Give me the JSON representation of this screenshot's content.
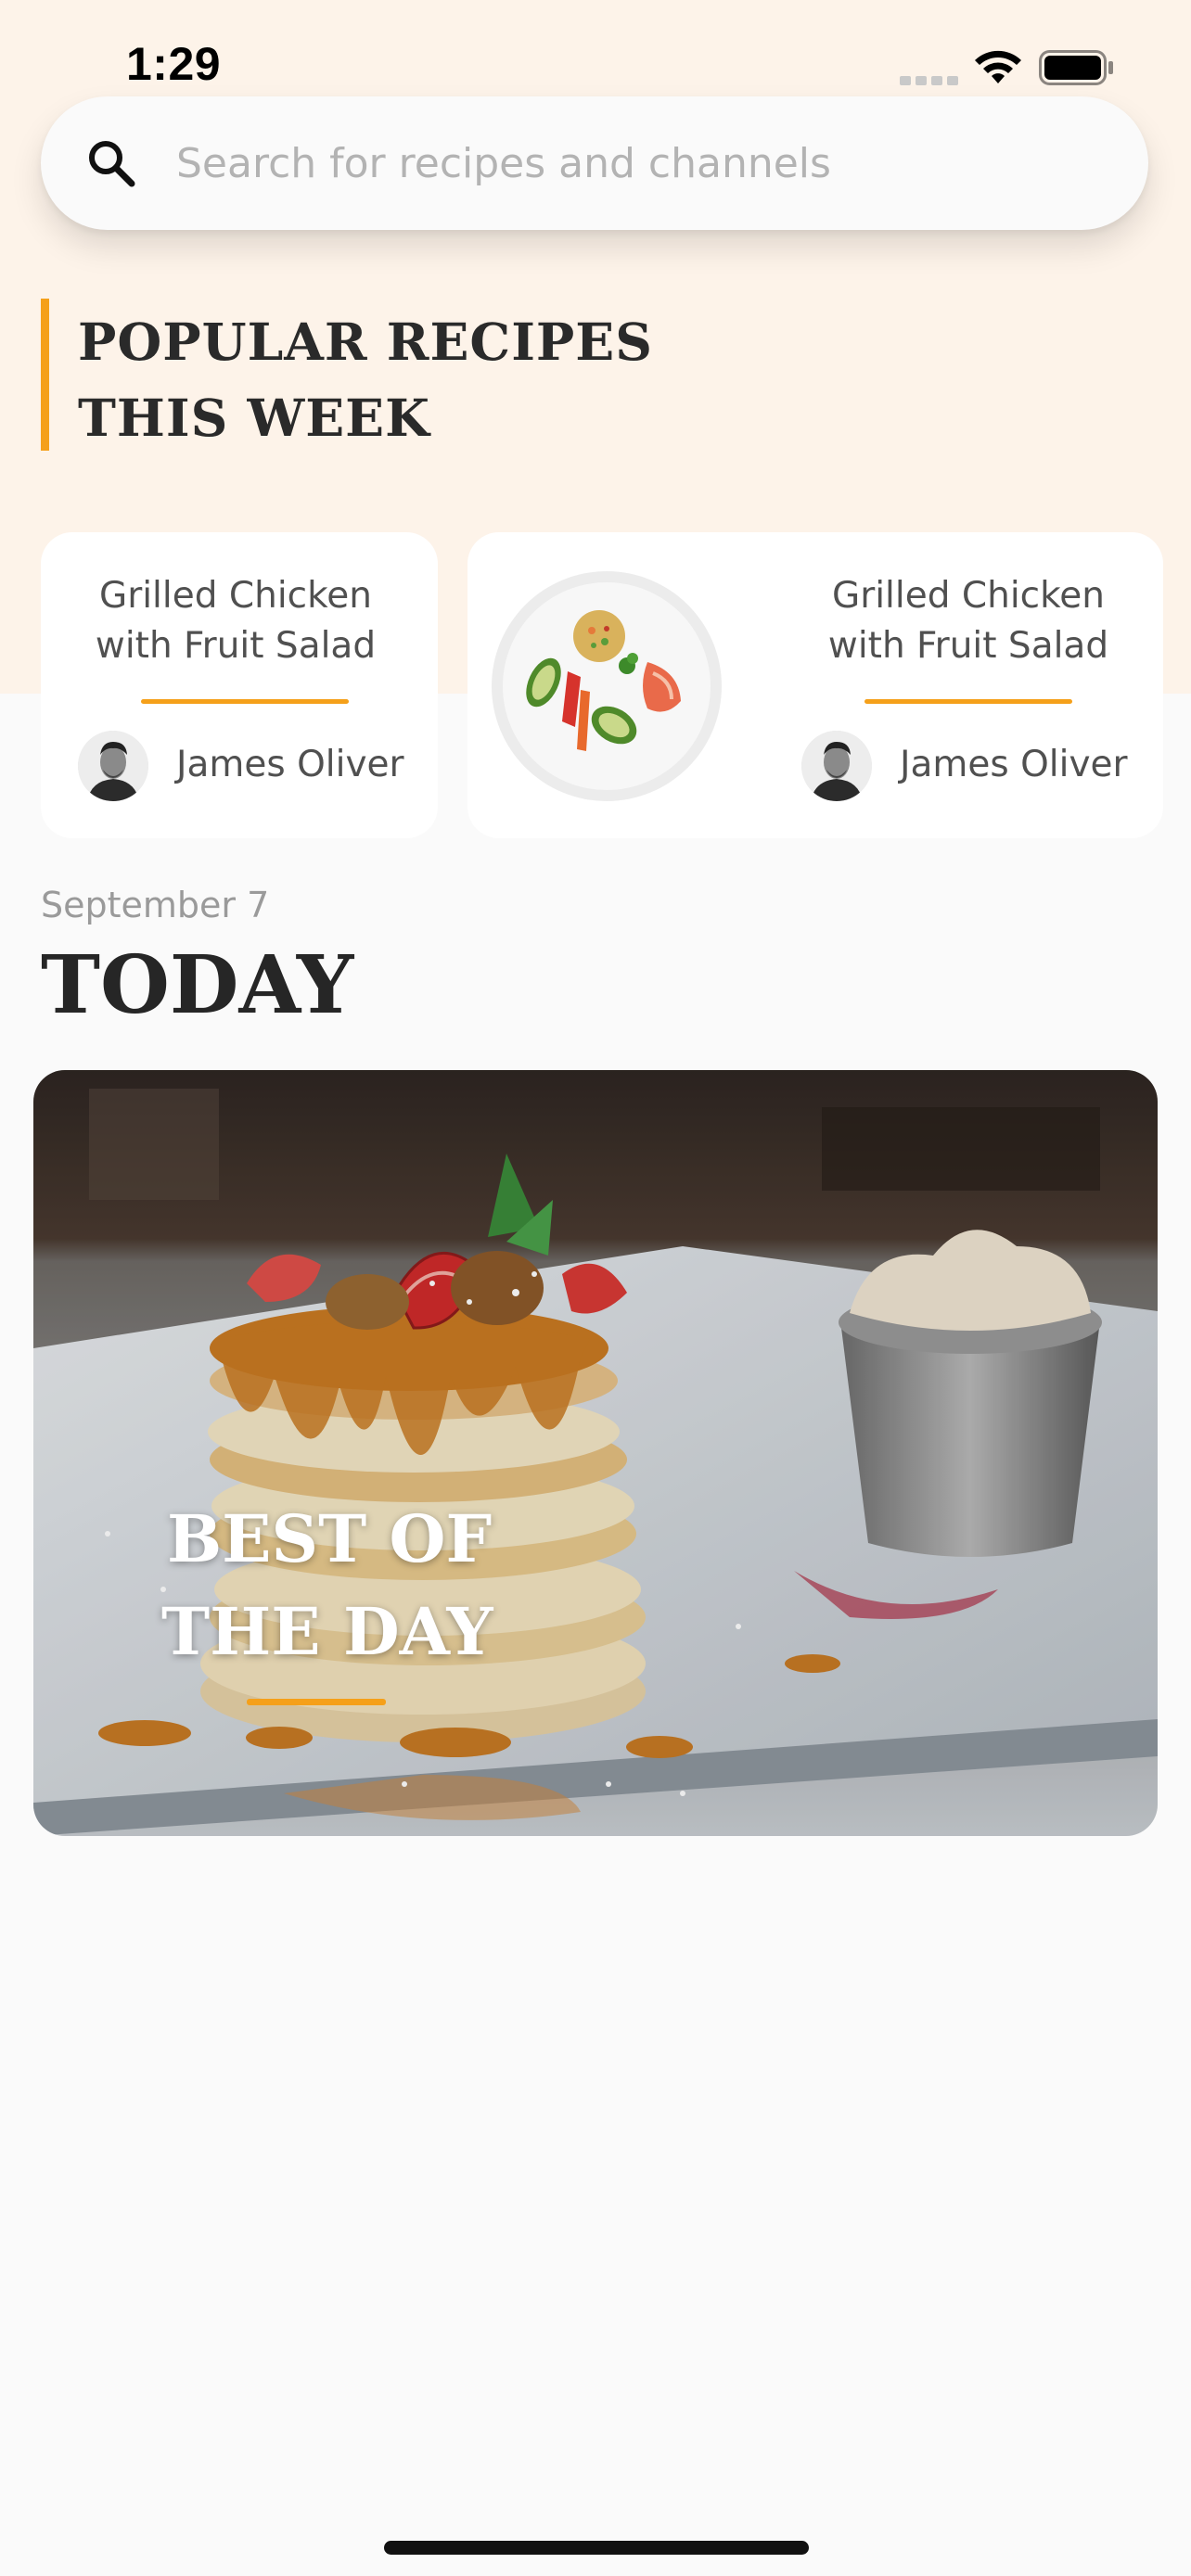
{
  "status_bar": {
    "time": "1:29"
  },
  "search": {
    "placeholder": "Search for recipes and channels"
  },
  "popular": {
    "title_line1": "POPULAR RECIPES",
    "title_line2": "THIS WEEK",
    "cards": [
      {
        "title_line1": "Grilled Chicken",
        "title_line2": "with Fruit Salad",
        "author": "James Oliver"
      },
      {
        "title_line1": "Grilled Chicken",
        "title_line2": "with Fruit Salad",
        "author": "James Oliver"
      }
    ]
  },
  "today": {
    "date": "September 7",
    "title": "TODAY",
    "feature": {
      "title_line1": "BEST OF",
      "title_line2": "THE DAY"
    }
  },
  "colors": {
    "accent": "#f5a01a",
    "header_background": "#fdf3e9",
    "page_background": "#fafafa"
  },
  "icons": {
    "search": "search-icon",
    "wifi": "wifi-icon",
    "battery": "battery-icon",
    "signal": "signal-icon"
  }
}
